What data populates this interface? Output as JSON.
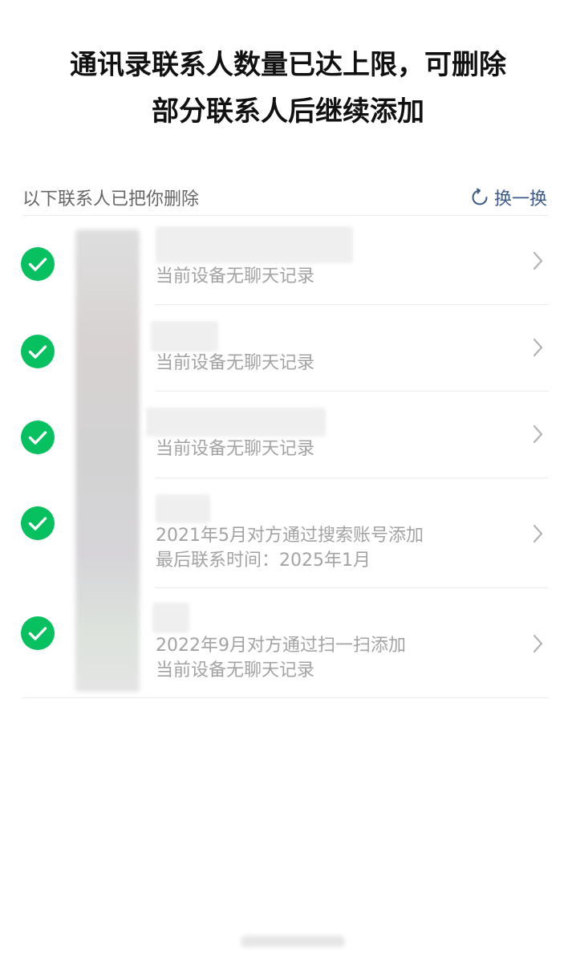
{
  "dialog": {
    "title_line1": "通讯录联系人数量已达上限，可删除",
    "title_line2": "部分联系人后继续添加"
  },
  "section": {
    "label": "以下联系人已把你删除",
    "refresh_label": "换一换",
    "refresh_icon": "refresh-icon",
    "accent_color": "#3b5a86"
  },
  "contacts": [
    {
      "selected": true,
      "lines": [
        "当前设备无聊天记录"
      ]
    },
    {
      "selected": true,
      "lines": [
        "当前设备无聊天记录"
      ]
    },
    {
      "selected": true,
      "lines": [
        "当前设备无聊天记录"
      ]
    },
    {
      "selected": true,
      "lines": [
        "2021年5月对方通过搜索账号添加",
        "最后联系时间：2025年1月"
      ]
    },
    {
      "selected": true,
      "lines": [
        "2022年9月对方通过扫一扫添加",
        "当前设备无聊天记录"
      ]
    }
  ],
  "colors": {
    "check_green": "#07c160",
    "secondary_text": "#a3a3a3",
    "divider": "#ececec"
  }
}
